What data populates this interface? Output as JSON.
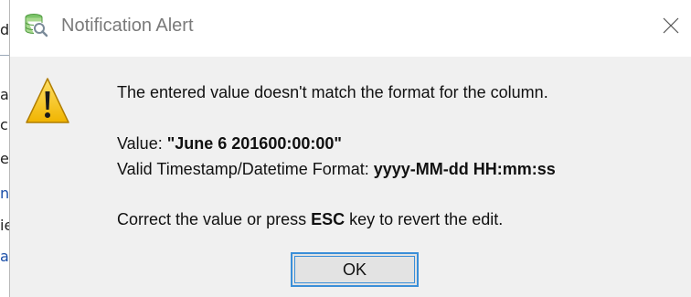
{
  "background_app": {
    "fragments": [
      "d",
      "a",
      "c",
      "e",
      "n",
      "ie",
      "a"
    ]
  },
  "dialog": {
    "title": "Notification Alert",
    "app_icon": "database-search-icon",
    "close_icon": "close-icon",
    "warning_icon": "warning-triangle-icon",
    "message": {
      "line1": "The entered value doesn't match the format for the column.",
      "value_label": "Value:",
      "value": "\"June 6 201600:00:00\"",
      "format_label": "Valid Timestamp/Datetime Format:",
      "format": "yyyy-MM-dd HH:mm:ss",
      "correct_prefix": "Correct the value or press",
      "key": "ESC",
      "correct_suffix": "key to revert the edit."
    },
    "ok_label": "OK"
  },
  "colors": {
    "dialog_bg": "#f0f0f0",
    "titlebar_bg": "#ffffff",
    "button_focus": "#3b8fd8",
    "warning_yellow": "#f5c518"
  }
}
